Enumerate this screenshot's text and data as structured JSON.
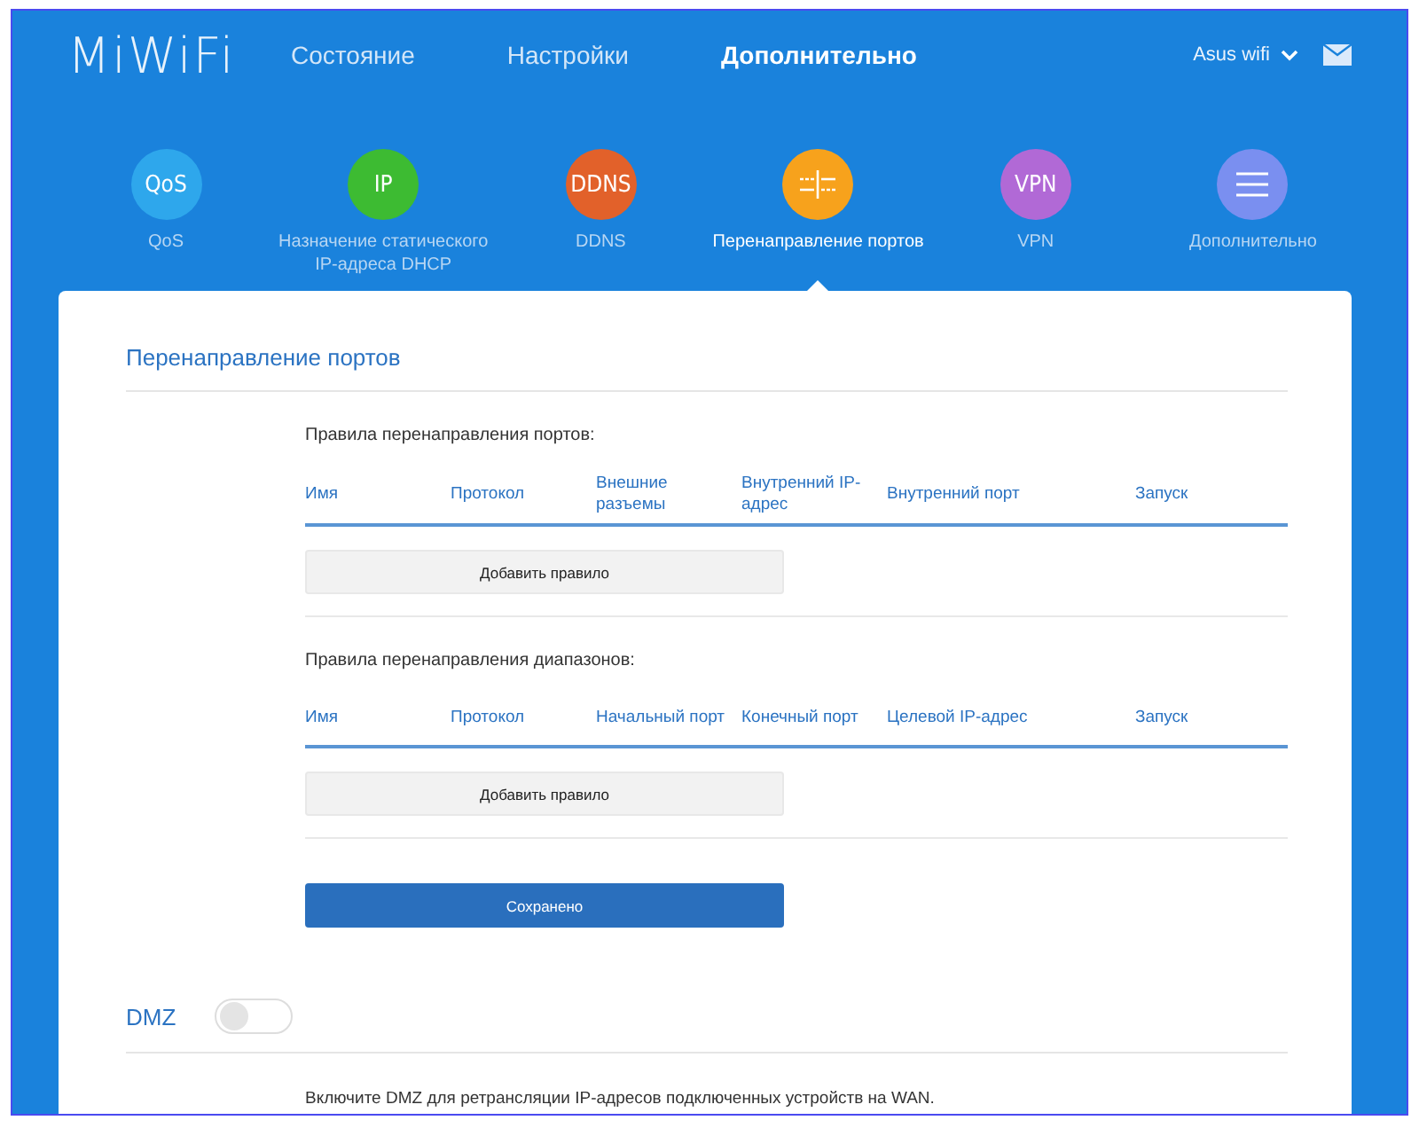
{
  "header": {
    "logo": "MiWiFi",
    "nav": [
      {
        "label": "Состояние",
        "selected": false
      },
      {
        "label": "Настройки",
        "selected": false
      },
      {
        "label": "Дополнительно",
        "selected": true
      }
    ],
    "user": "Asus wifi"
  },
  "features": [
    {
      "kind": "text",
      "badge": "QoS",
      "label": "QoS",
      "color": "#2ea7ec",
      "selected": false
    },
    {
      "kind": "text",
      "badge": "IP",
      "label": "Назначение статического IP-адреса DHCP",
      "color": "#3dbb32",
      "selected": false
    },
    {
      "kind": "text",
      "badge": "DDNS",
      "label": "DDNS",
      "color": "#e2612a",
      "selected": false
    },
    {
      "kind": "ports",
      "label": "Перенаправление портов",
      "color": "#f7a21c",
      "selected": true
    },
    {
      "kind": "text",
      "badge": "VPN",
      "label": "VPN",
      "color": "#b169d6",
      "selected": false
    },
    {
      "kind": "menu",
      "label": "Дополнительно",
      "color": "#7a8ff0",
      "selected": false
    }
  ],
  "section": {
    "title": "Перенаправление портов",
    "tables": [
      {
        "title": "Правила перенаправления портов:",
        "columns": [
          "Имя",
          "Протокол",
          "Внешние разъемы",
          "Внутренний IP-адрес",
          "Внутренний порт",
          "Запуск"
        ],
        "button": "Добавить правило"
      },
      {
        "title": "Правила перенаправления диапазонов:",
        "columns": [
          "Имя",
          "Протокол",
          "Начальный порт",
          "Конечный порт",
          "Целевой IP-адрес",
          "Запуск"
        ],
        "button": "Добавить правило"
      }
    ],
    "save_button": "Сохранено"
  },
  "dmz": {
    "title": "DMZ",
    "on": false,
    "description": "Включите DMZ для ретрансляции IP-адресов подключенных устройств на WAN."
  }
}
